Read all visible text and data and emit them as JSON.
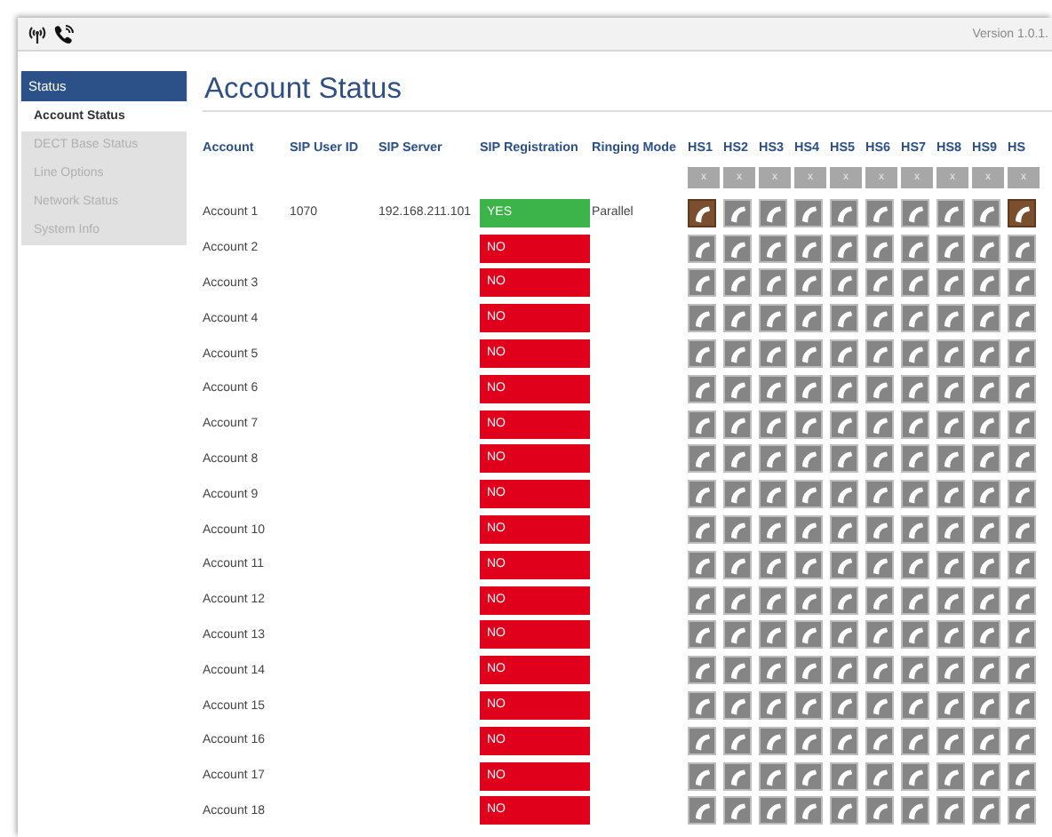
{
  "header": {
    "version": "Version 1.0.1."
  },
  "sidebar": {
    "section": "Status",
    "items": [
      {
        "label": "Account Status",
        "selected": true
      },
      {
        "label": "DECT Base Status",
        "selected": false
      },
      {
        "label": "Line Options",
        "selected": false
      },
      {
        "label": "Network Status",
        "selected": false
      },
      {
        "label": "System Info",
        "selected": false
      }
    ]
  },
  "page_title": "Account Status",
  "table": {
    "columns": [
      "Account",
      "SIP User ID",
      "SIP Server",
      "SIP Registration",
      "Ringing Mode"
    ],
    "handset_columns": [
      {
        "label": "HS1",
        "clear": "x"
      },
      {
        "label": "HS2",
        "clear": "x"
      },
      {
        "label": "HS3",
        "clear": "x"
      },
      {
        "label": "HS4",
        "clear": "x"
      },
      {
        "label": "HS5",
        "clear": "x"
      },
      {
        "label": "HS6",
        "clear": "x"
      },
      {
        "label": "HS7",
        "clear": "x"
      },
      {
        "label": "HS8",
        "clear": "x"
      },
      {
        "label": "HS9",
        "clear": "x"
      },
      {
        "label": "HS",
        "clear": "x"
      }
    ],
    "rows": [
      {
        "account": "Account 1",
        "sip_user_id": "1070",
        "sip_server": "192.168.211.101",
        "registration": "YES",
        "registered": true,
        "ringing_mode": "Parallel",
        "handsets": [
          {
            "active": true
          },
          {
            "active": false
          },
          {
            "active": false
          },
          {
            "active": false
          },
          {
            "active": false
          },
          {
            "active": false
          },
          {
            "active": false
          },
          {
            "active": false
          },
          {
            "active": false
          },
          {
            "active": true
          }
        ]
      },
      {
        "account": "Account 2",
        "registration": "NO",
        "registered": false,
        "handsets": [
          {
            "active": false
          },
          {
            "active": false
          },
          {
            "active": false
          },
          {
            "active": false
          },
          {
            "active": false
          },
          {
            "active": false
          },
          {
            "active": false
          },
          {
            "active": false
          },
          {
            "active": false
          },
          {
            "active": false
          }
        ]
      },
      {
        "account": "Account 3",
        "registration": "NO",
        "registered": false,
        "handsets": [
          {
            "active": false
          },
          {
            "active": false
          },
          {
            "active": false
          },
          {
            "active": false
          },
          {
            "active": false
          },
          {
            "active": false
          },
          {
            "active": false
          },
          {
            "active": false
          },
          {
            "active": false
          },
          {
            "active": false
          }
        ]
      },
      {
        "account": "Account 4",
        "registration": "NO",
        "registered": false,
        "handsets": [
          {
            "active": false
          },
          {
            "active": false
          },
          {
            "active": false
          },
          {
            "active": false
          },
          {
            "active": false
          },
          {
            "active": false
          },
          {
            "active": false
          },
          {
            "active": false
          },
          {
            "active": false
          },
          {
            "active": false
          }
        ]
      },
      {
        "account": "Account 5",
        "registration": "NO",
        "registered": false,
        "handsets": [
          {
            "active": false
          },
          {
            "active": false
          },
          {
            "active": false
          },
          {
            "active": false
          },
          {
            "active": false
          },
          {
            "active": false
          },
          {
            "active": false
          },
          {
            "active": false
          },
          {
            "active": false
          },
          {
            "active": false
          }
        ]
      },
      {
        "account": "Account 6",
        "registration": "NO",
        "registered": false,
        "handsets": [
          {
            "active": false
          },
          {
            "active": false
          },
          {
            "active": false
          },
          {
            "active": false
          },
          {
            "active": false
          },
          {
            "active": false
          },
          {
            "active": false
          },
          {
            "active": false
          },
          {
            "active": false
          },
          {
            "active": false
          }
        ]
      },
      {
        "account": "Account 7",
        "registration": "NO",
        "registered": false,
        "handsets": [
          {
            "active": false
          },
          {
            "active": false
          },
          {
            "active": false
          },
          {
            "active": false
          },
          {
            "active": false
          },
          {
            "active": false
          },
          {
            "active": false
          },
          {
            "active": false
          },
          {
            "active": false
          },
          {
            "active": false
          }
        ]
      },
      {
        "account": "Account 8",
        "registration": "NO",
        "registered": false,
        "handsets": [
          {
            "active": false
          },
          {
            "active": false
          },
          {
            "active": false
          },
          {
            "active": false
          },
          {
            "active": false
          },
          {
            "active": false
          },
          {
            "active": false
          },
          {
            "active": false
          },
          {
            "active": false
          },
          {
            "active": false
          }
        ]
      },
      {
        "account": "Account 9",
        "registration": "NO",
        "registered": false,
        "handsets": [
          {
            "active": false
          },
          {
            "active": false
          },
          {
            "active": false
          },
          {
            "active": false
          },
          {
            "active": false
          },
          {
            "active": false
          },
          {
            "active": false
          },
          {
            "active": false
          },
          {
            "active": false
          },
          {
            "active": false
          }
        ]
      },
      {
        "account": "Account 10",
        "registration": "NO",
        "registered": false,
        "handsets": [
          {
            "active": false
          },
          {
            "active": false
          },
          {
            "active": false
          },
          {
            "active": false
          },
          {
            "active": false
          },
          {
            "active": false
          },
          {
            "active": false
          },
          {
            "active": false
          },
          {
            "active": false
          },
          {
            "active": false
          }
        ]
      },
      {
        "account": "Account 11",
        "registration": "NO",
        "registered": false,
        "handsets": [
          {
            "active": false
          },
          {
            "active": false
          },
          {
            "active": false
          },
          {
            "active": false
          },
          {
            "active": false
          },
          {
            "active": false
          },
          {
            "active": false
          },
          {
            "active": false
          },
          {
            "active": false
          },
          {
            "active": false
          }
        ]
      },
      {
        "account": "Account 12",
        "registration": "NO",
        "registered": false,
        "handsets": [
          {
            "active": false
          },
          {
            "active": false
          },
          {
            "active": false
          },
          {
            "active": false
          },
          {
            "active": false
          },
          {
            "active": false
          },
          {
            "active": false
          },
          {
            "active": false
          },
          {
            "active": false
          },
          {
            "active": false
          }
        ]
      },
      {
        "account": "Account 13",
        "registration": "NO",
        "registered": false,
        "handsets": [
          {
            "active": false
          },
          {
            "active": false
          },
          {
            "active": false
          },
          {
            "active": false
          },
          {
            "active": false
          },
          {
            "active": false
          },
          {
            "active": false
          },
          {
            "active": false
          },
          {
            "active": false
          },
          {
            "active": false
          }
        ]
      },
      {
        "account": "Account 14",
        "registration": "NO",
        "registered": false,
        "handsets": [
          {
            "active": false
          },
          {
            "active": false
          },
          {
            "active": false
          },
          {
            "active": false
          },
          {
            "active": false
          },
          {
            "active": false
          },
          {
            "active": false
          },
          {
            "active": false
          },
          {
            "active": false
          },
          {
            "active": false
          }
        ]
      },
      {
        "account": "Account 15",
        "registration": "NO",
        "registered": false,
        "handsets": [
          {
            "active": false
          },
          {
            "active": false
          },
          {
            "active": false
          },
          {
            "active": false
          },
          {
            "active": false
          },
          {
            "active": false
          },
          {
            "active": false
          },
          {
            "active": false
          },
          {
            "active": false
          },
          {
            "active": false
          }
        ]
      },
      {
        "account": "Account 16",
        "registration": "NO",
        "registered": false,
        "handsets": [
          {
            "active": false
          },
          {
            "active": false
          },
          {
            "active": false
          },
          {
            "active": false
          },
          {
            "active": false
          },
          {
            "active": false
          },
          {
            "active": false
          },
          {
            "active": false
          },
          {
            "active": false
          },
          {
            "active": false
          }
        ]
      },
      {
        "account": "Account 17",
        "registration": "NO",
        "registered": false,
        "handsets": [
          {
            "active": false
          },
          {
            "active": false
          },
          {
            "active": false
          },
          {
            "active": false
          },
          {
            "active": false
          },
          {
            "active": false
          },
          {
            "active": false
          },
          {
            "active": false
          },
          {
            "active": false
          },
          {
            "active": false
          }
        ]
      },
      {
        "account": "Account 18",
        "registration": "NO",
        "registered": false,
        "handsets": [
          {
            "active": false
          },
          {
            "active": false
          },
          {
            "active": false
          },
          {
            "active": false
          },
          {
            "active": false
          },
          {
            "active": false
          },
          {
            "active": false
          },
          {
            "active": false
          },
          {
            "active": false
          },
          {
            "active": false
          }
        ]
      }
    ]
  }
}
